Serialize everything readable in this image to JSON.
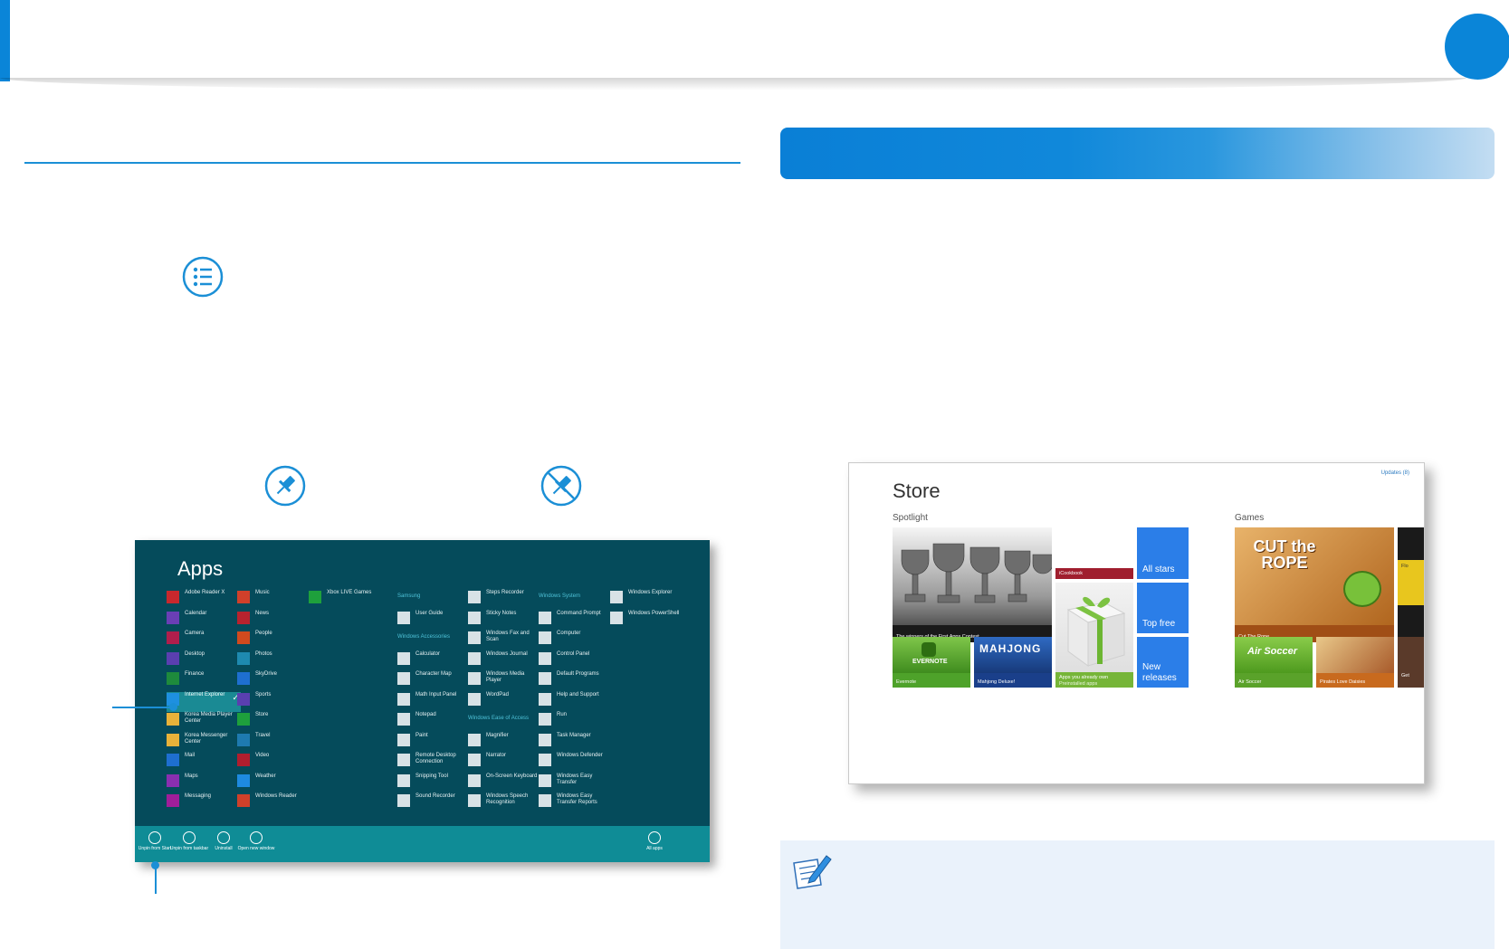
{
  "colors": {
    "accent": "#0a85d8",
    "apps_bg": "#054b5b",
    "apps_bar": "#0f8c96",
    "store_blue": "#2b7ee8"
  },
  "icons": [
    "menu-list-icon",
    "pin-icon",
    "unpin-icon",
    "note-pencil-icon"
  ],
  "apps_screen": {
    "title": "Apps",
    "columns": [
      [
        {
          "label": "Adobe Reader X",
          "icon": "pdf-icon",
          "color": "#c8282d"
        },
        {
          "label": "Calendar",
          "icon": "calendar-icon",
          "color": "#6a3fb5"
        },
        {
          "label": "Camera",
          "icon": "camera-icon",
          "color": "#b01e4c"
        },
        {
          "label": "Desktop",
          "icon": "desktop-icon",
          "color": "#5a3fb0"
        },
        {
          "label": "Finance",
          "icon": "finance-icon",
          "color": "#1e8a3c"
        },
        {
          "label": "Internet Explorer",
          "icon": "ie-icon",
          "color": "#1e90e0",
          "selected": true
        },
        {
          "label": "Korea Media Player Center",
          "icon": "folder-icon",
          "color": "#e8b23a"
        },
        {
          "label": "Korea Messenger Center",
          "icon": "folder-icon",
          "color": "#e8b23a"
        },
        {
          "label": "Mail",
          "icon": "mail-icon",
          "color": "#1e6fd0"
        },
        {
          "label": "Maps",
          "icon": "maps-icon",
          "color": "#8a2fb0"
        },
        {
          "label": "Messaging",
          "icon": "messaging-icon",
          "color": "#a01e9a"
        }
      ],
      [
        {
          "label": "Music",
          "icon": "music-icon",
          "color": "#d0402a"
        },
        {
          "label": "News",
          "icon": "news-icon",
          "color": "#b8232e"
        },
        {
          "label": "People",
          "icon": "people-icon",
          "color": "#d04a1e"
        },
        {
          "label": "Photos",
          "icon": "photos-icon",
          "color": "#1e8ab0"
        },
        {
          "label": "SkyDrive",
          "icon": "skydrive-icon",
          "color": "#1e6fd0"
        },
        {
          "label": "Sports",
          "icon": "sports-icon",
          "color": "#5a3fb0"
        },
        {
          "label": "Store",
          "icon": "store-icon",
          "color": "#1ea03c"
        },
        {
          "label": "Travel",
          "icon": "travel-icon",
          "color": "#1e7ab0"
        },
        {
          "label": "Video",
          "icon": "video-icon",
          "color": "#b01e2e"
        },
        {
          "label": "Weather",
          "icon": "weather-icon",
          "color": "#1e8ae0"
        },
        {
          "label": "Windows Reader",
          "icon": "reader-icon",
          "color": "#d0402a"
        }
      ],
      [
        {
          "label": "Xbox LIVE Games",
          "icon": "xbox-icon",
          "color": "#1ea03c"
        }
      ]
    ],
    "groups": [
      {
        "title": "Samsung",
        "items": [
          {
            "label": "User Guide",
            "icon": "guide-icon"
          }
        ]
      },
      {
        "title": "Windows Accessories",
        "items": [
          {
            "label": "Calculator",
            "icon": "calc-icon"
          },
          {
            "label": "Character Map",
            "icon": "charmap-icon"
          },
          {
            "label": "Math Input Panel",
            "icon": "math-icon"
          },
          {
            "label": "Notepad",
            "icon": "notepad-icon"
          },
          {
            "label": "Paint",
            "icon": "paint-icon"
          },
          {
            "label": "Remote Desktop Connection",
            "icon": "remote-icon"
          },
          {
            "label": "Snipping Tool",
            "icon": "snip-icon"
          },
          {
            "label": "Sound Recorder",
            "icon": "mic-icon"
          }
        ]
      }
    ],
    "col4": [
      {
        "label": "Steps Recorder",
        "icon": "steps-icon"
      },
      {
        "label": "Sticky Notes",
        "icon": "sticky-icon"
      },
      {
        "label": "Windows Fax and Scan",
        "icon": "fax-icon"
      },
      {
        "label": "Windows Journal",
        "icon": "journal-icon"
      },
      {
        "label": "Windows Media Player",
        "icon": "media-icon"
      },
      {
        "label": "WordPad",
        "icon": "wordpad-icon"
      }
    ],
    "ease_title": "Windows Ease of Access",
    "ease": [
      {
        "label": "Magnifier",
        "icon": "magnifier-icon"
      },
      {
        "label": "Narrator",
        "icon": "narrator-icon"
      },
      {
        "label": "On-Screen Keyboard",
        "icon": "keyboard-icon"
      },
      {
        "label": "Windows Speech Recognition",
        "icon": "speech-icon"
      }
    ],
    "system_title": "Windows System",
    "system": [
      {
        "label": "Command Prompt",
        "icon": "cmd-icon"
      },
      {
        "label": "Computer",
        "icon": "computer-icon"
      },
      {
        "label": "Control Panel",
        "icon": "control-icon"
      },
      {
        "label": "Default Programs",
        "icon": "default-icon"
      },
      {
        "label": "Help and Support",
        "icon": "help-icon"
      },
      {
        "label": "Run",
        "icon": "run-icon"
      },
      {
        "label": "Task Manager",
        "icon": "task-icon"
      },
      {
        "label": "Windows Defender",
        "icon": "defender-icon"
      },
      {
        "label": "Windows Easy Transfer",
        "icon": "transfer-icon"
      },
      {
        "label": "Windows Easy Transfer Reports",
        "icon": "transfer-icon"
      }
    ],
    "col6": [
      {
        "label": "Windows Explorer",
        "icon": "explorer-icon"
      },
      {
        "label": "Windows PowerShell",
        "icon": "powershell-icon"
      }
    ],
    "bar": [
      {
        "label": "Unpin from Start",
        "icon": "unpin-start-icon"
      },
      {
        "label": "Unpin from taskbar",
        "icon": "unpin-taskbar-icon"
      },
      {
        "label": "Uninstall",
        "icon": "uninstall-icon"
      },
      {
        "label": "Open new window",
        "icon": "new-window-icon"
      },
      {
        "label": "All apps",
        "icon": "all-apps-icon"
      }
    ]
  },
  "store_screen": {
    "title": "Store",
    "updates": "Updates (8)",
    "spotlight": "Spotlight",
    "games": "Games",
    "tiles": {
      "winners": "The winners of the First Apps Contest",
      "icookbook_logo": "iCookbook",
      "icookbook": "iCookbook",
      "all_stars": "All stars",
      "top_free": "Top free",
      "new_releases": "New releases",
      "evernote_logo": "EVERNOTE",
      "evernote": "Evernote",
      "mahjong_logo": "MAHJONG",
      "mahjong": "Mahjong Deluxe!",
      "apps_own": "Apps you already own",
      "preinstalled": "Preinstalled apps",
      "cut_rope_logo": "CUT the ROPE",
      "cut_rope": "Cut The Rope",
      "air_soccer_logo": "Air Soccer",
      "air_soccer": "Air Soccer",
      "pirates": "Pirates Love Daisies",
      "flo": "Flo",
      "get": "Get"
    }
  }
}
